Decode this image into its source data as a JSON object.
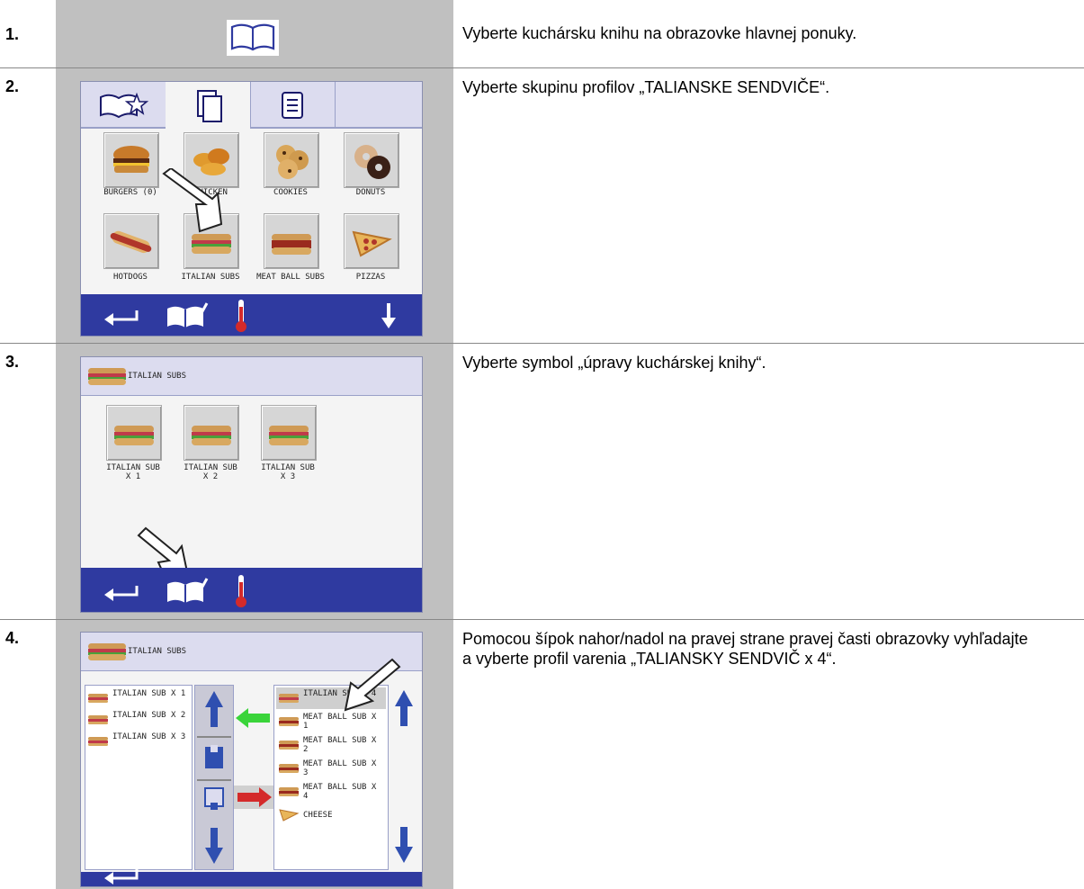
{
  "steps": [
    {
      "num": "1.",
      "text": "Vyberte kuchársku knihu na obrazovke hlavnej ponuky."
    },
    {
      "num": "2.",
      "text": "Vyberte skupinu profilov „TALIANSKE SENDVIČE“."
    },
    {
      "num": "3.",
      "text": "Vyberte symbol „úpravy kuchárskej knihy“."
    },
    {
      "num": "4.",
      "text": "Pomocou šípok nahor/nadol na pravej strane pravej časti obrazovky vyhľadajte a vyberte profil varenia „TALIANSKY SENDVIČ x 4“."
    }
  ],
  "screen2": {
    "tiles": [
      {
        "label": "BURGERS (0)",
        "icon": "burger-icon"
      },
      {
        "label": "CHICKEN",
        "icon": "chicken-icon"
      },
      {
        "label": "COOKIES",
        "icon": "cookies-icon"
      },
      {
        "label": "DONUTS",
        "icon": "donuts-icon"
      },
      {
        "label": "HOTDOGS",
        "icon": "hotdog-icon"
      },
      {
        "label": "ITALIAN SUBS",
        "icon": "sub-icon"
      },
      {
        "label": "MEAT BALL SUBS",
        "icon": "meatball-sub-icon"
      },
      {
        "label": "PIZZAS",
        "icon": "pizza-icon"
      }
    ]
  },
  "screen3": {
    "title": "ITALIAN SUBS",
    "tiles": [
      "ITALIAN SUB X 1",
      "ITALIAN SUB X 2",
      "ITALIAN SUB X 3"
    ]
  },
  "screen4": {
    "title": "ITALIAN SUBS",
    "left_list": [
      "ITALIAN SUB X 1",
      "ITALIAN SUB X 2",
      "ITALIAN SUB X 3"
    ],
    "right_list": [
      "ITALIAN SUB X 4",
      "MEAT BALL SUB X 1",
      "MEAT BALL SUB X 2",
      "MEAT BALL SUB X 3",
      "MEAT BALL SUB X 4",
      "CHEESE"
    ]
  },
  "colors": {
    "bar": "#2f3aa0",
    "header": "#dcdcef",
    "green_arrow": "#3ad43a",
    "red_arrow": "#d42a2a",
    "up_down": "#2f4fb0"
  }
}
